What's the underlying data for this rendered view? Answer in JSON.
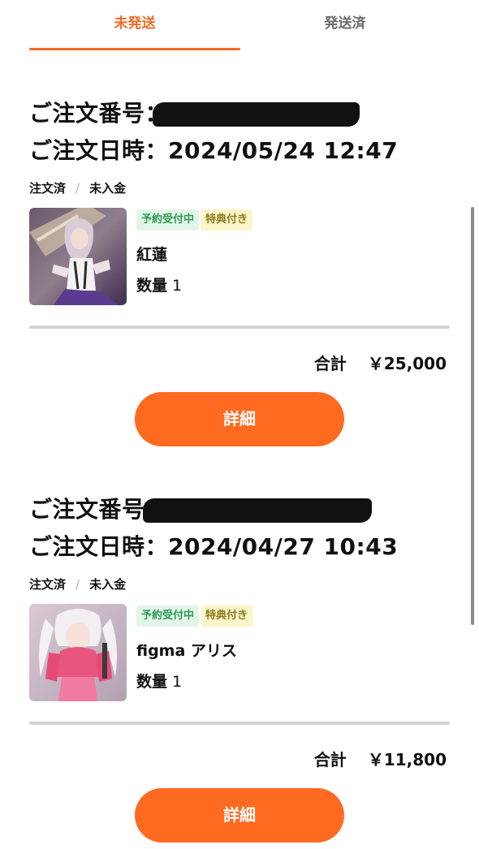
{
  "tabs": {
    "unshipped": "未発送",
    "shipped": "発送済"
  },
  "colors": {
    "accent": "#f26a24",
    "button": "#ff6a21",
    "badge_green_bg": "#e3f5e9",
    "badge_yellow_bg": "#fbf5c8"
  },
  "orders": [
    {
      "number_label": "ご注文番号：",
      "date_text": "ご注文日時：2024/05/24 12:47",
      "status_ordered": "注文済",
      "status_separator": "/",
      "status_payment": "未入金",
      "badge_preorder": "予約受付中",
      "badge_bonus": "特典付き",
      "product_name": "紅蓮",
      "qty_label": "数量",
      "qty_value": "1",
      "total_label": "合計",
      "total_amount": "￥25,000",
      "detail_button": "詳細"
    },
    {
      "number_label": "ご注文番号：",
      "date_text": "ご注文日時：2024/04/27 10:43",
      "status_ordered": "注文済",
      "status_separator": "/",
      "status_payment": "未入金",
      "badge_preorder": "予約受付中",
      "badge_bonus": "特典付き",
      "product_name": "figma アリス",
      "qty_label": "数量",
      "qty_value": "1",
      "total_label": "合計",
      "total_amount": "￥11,800",
      "detail_button": "詳細"
    }
  ]
}
